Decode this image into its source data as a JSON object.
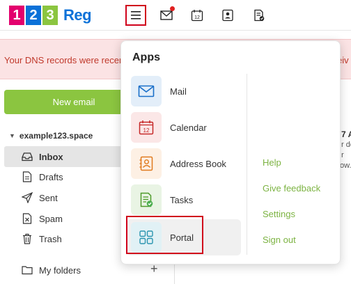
{
  "logo": {
    "digits": [
      "1",
      "2",
      "3"
    ],
    "digit_colors": [
      "#e3006d",
      "#0b71d8",
      "#8bc540"
    ],
    "brand": "Reg"
  },
  "topbar": {
    "icons": [
      "menu-icon",
      "mail-icon",
      "calendar-icon",
      "address-book-icon",
      "tasks-icon"
    ],
    "calendar_day": "12",
    "mail_has_notification": true
  },
  "banner": {
    "text": "Your DNS records were recen",
    "text_right": "eiv"
  },
  "sidebar": {
    "new_email": "New email",
    "account": "example123.space",
    "folders": [
      {
        "label": "Inbox",
        "icon": "inbox-icon",
        "active": true
      },
      {
        "label": "Drafts",
        "icon": "drafts-icon",
        "active": false
      },
      {
        "label": "Sent",
        "icon": "sent-icon",
        "active": false
      },
      {
        "label": "Spam",
        "icon": "spam-icon",
        "active": false
      },
      {
        "label": "Trash",
        "icon": "trash-icon",
        "active": false
      }
    ],
    "my_folders": "My folders",
    "add": "+"
  },
  "peek": {
    "line1": "7 A",
    "line2": "r de",
    "line3": "r",
    "line4": "ow..."
  },
  "dropdown": {
    "title": "Apps",
    "apps": [
      {
        "label": "Mail",
        "icon": "mail-icon",
        "tile_color": "#e3eef9"
      },
      {
        "label": "Calendar",
        "icon": "calendar-icon",
        "tile_color": "#fbe7e7",
        "day": "12"
      },
      {
        "label": "Address Book",
        "icon": "address-book-icon",
        "tile_color": "#fdf0e4"
      },
      {
        "label": "Tasks",
        "icon": "tasks-icon",
        "tile_color": "#e9f4e4"
      },
      {
        "label": "Portal",
        "icon": "portal-icon",
        "tile_color": "#e1f1f5",
        "highlighted": true
      }
    ],
    "links": [
      "Help",
      "Give feedback",
      "Settings",
      "Sign out"
    ]
  },
  "colors": {
    "accent_green": "#8bc540",
    "link_green": "#7cb342",
    "alert_red": "#d0021b",
    "banner_bg": "#fbe3e4"
  }
}
